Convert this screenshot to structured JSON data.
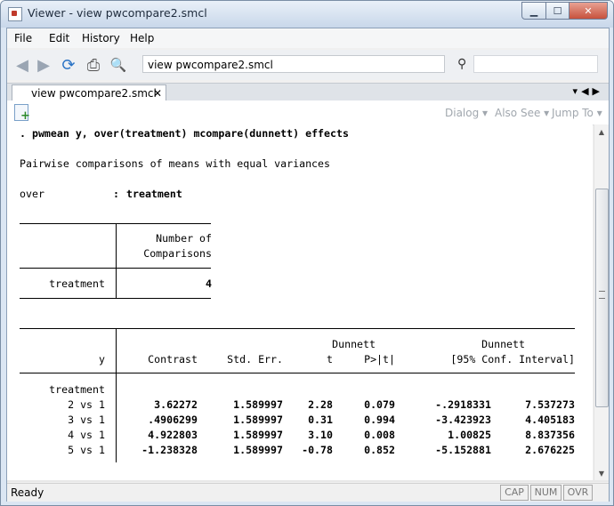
{
  "window": {
    "title": "Viewer - view pwcompare2.smcl"
  },
  "menu": [
    "File",
    "Edit",
    "History",
    "Help"
  ],
  "address": {
    "value": "view pwcompare2.smcl"
  },
  "tab": {
    "label": "view pwcompare2.smcl"
  },
  "subtoolbar": {
    "dialog": "Dialog",
    "also_see": "Also See",
    "jump_to": "Jump To"
  },
  "output": {
    "command_prefix": ". ",
    "command": "pwmean y, over(treatment) mcompare(dunnett) effects",
    "heading": "Pairwise comparisons of means with equal variances",
    "over_label": "over",
    "over_sep": ":",
    "over_value": "treatment",
    "cmp_table": {
      "header_line1": "Number of",
      "header_line2": "Comparisons",
      "row_label": "treatment",
      "row_value": "4"
    },
    "results_table": {
      "dunnett_t": "Dunnett",
      "dunnett_ci": "Dunnett",
      "col_y": "y",
      "col_contrast": "Contrast",
      "col_se": "Std. Err.",
      "col_t": "t",
      "col_p": "P>|t|",
      "col_ci": "[95% Conf. Interval]",
      "group_label": "treatment",
      "rows": [
        {
          "label": "2 vs 1",
          "contrast": "3.62272",
          "se": "1.589997",
          "t": "2.28",
          "p": "0.079",
          "lo": "-.2918331",
          "hi": "7.537273"
        },
        {
          "label": "3 vs 1",
          "contrast": ".4906299",
          "se": "1.589997",
          "t": "0.31",
          "p": "0.994",
          "lo": "-3.423923",
          "hi": "4.405183"
        },
        {
          "label": "4 vs 1",
          "contrast": "4.922803",
          "se": "1.589997",
          "t": "3.10",
          "p": "0.008",
          "lo": "1.00825",
          "hi": "8.837356"
        },
        {
          "label": "5 vs 1",
          "contrast": "-1.238328",
          "se": "1.589997",
          "t": "-0.78",
          "p": "0.852",
          "lo": "-5.152881",
          "hi": "2.676225"
        }
      ]
    }
  },
  "status": {
    "text": "Ready",
    "cap": "CAP",
    "num": "NUM",
    "ovr": "OVR"
  }
}
